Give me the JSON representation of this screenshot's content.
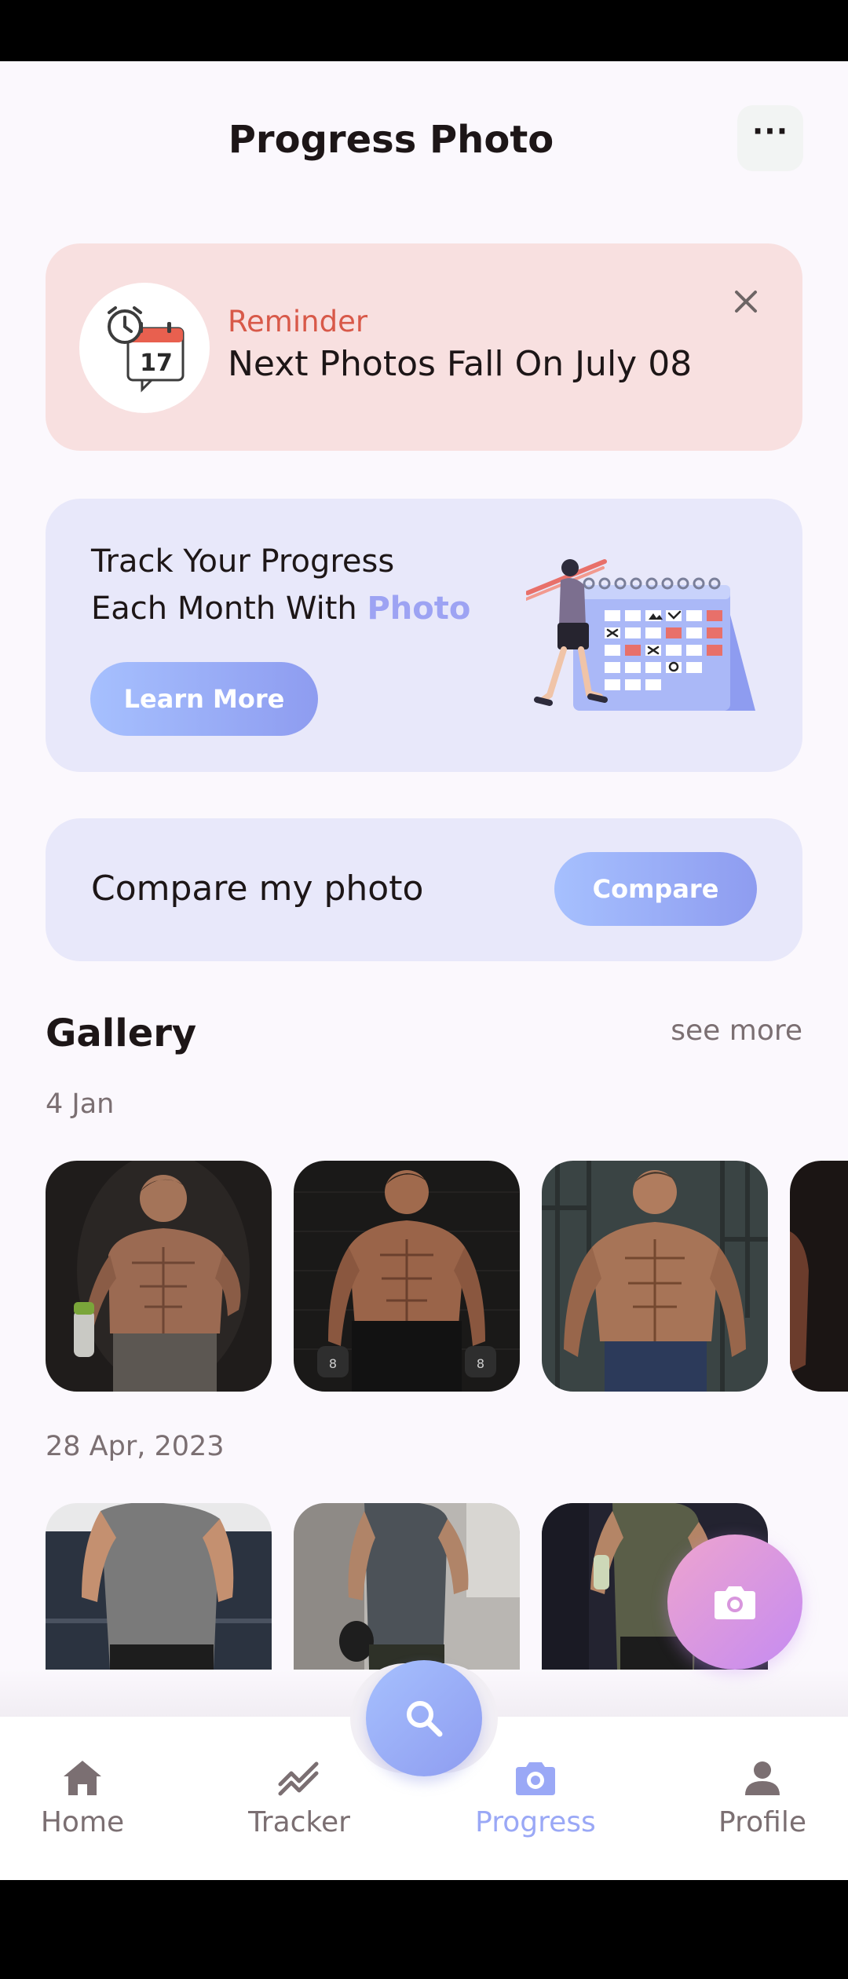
{
  "header": {
    "title": "Progress Photo",
    "more_label": "···"
  },
  "reminder": {
    "label": "Reminder",
    "text": "Next Photos Fall On July 08",
    "calendar_day": "17"
  },
  "track": {
    "line1": "Track Your Progress",
    "line2_prefix": "Each Month With ",
    "line2_accent": "Photo",
    "button_label": "Learn More"
  },
  "compare": {
    "text": "Compare my photo",
    "button_label": "Compare"
  },
  "gallery": {
    "title": "Gallery",
    "see_more": "see more",
    "groups": [
      {
        "date": "4 Jan"
      },
      {
        "date": "28 Apr, 2023"
      }
    ]
  },
  "nav": {
    "items": [
      {
        "label": "Home",
        "icon": "home-icon"
      },
      {
        "label": "Tracker",
        "icon": "activity-icon"
      },
      {
        "label": "Progress",
        "icon": "camera-icon",
        "active": true
      },
      {
        "label": "Profile",
        "icon": "user-icon"
      }
    ]
  },
  "colors": {
    "accent": "#9da3f3",
    "reminder_bg": "#f8e0e0",
    "card_bg": "#e8e8fa",
    "reminder_label": "#d85949"
  }
}
